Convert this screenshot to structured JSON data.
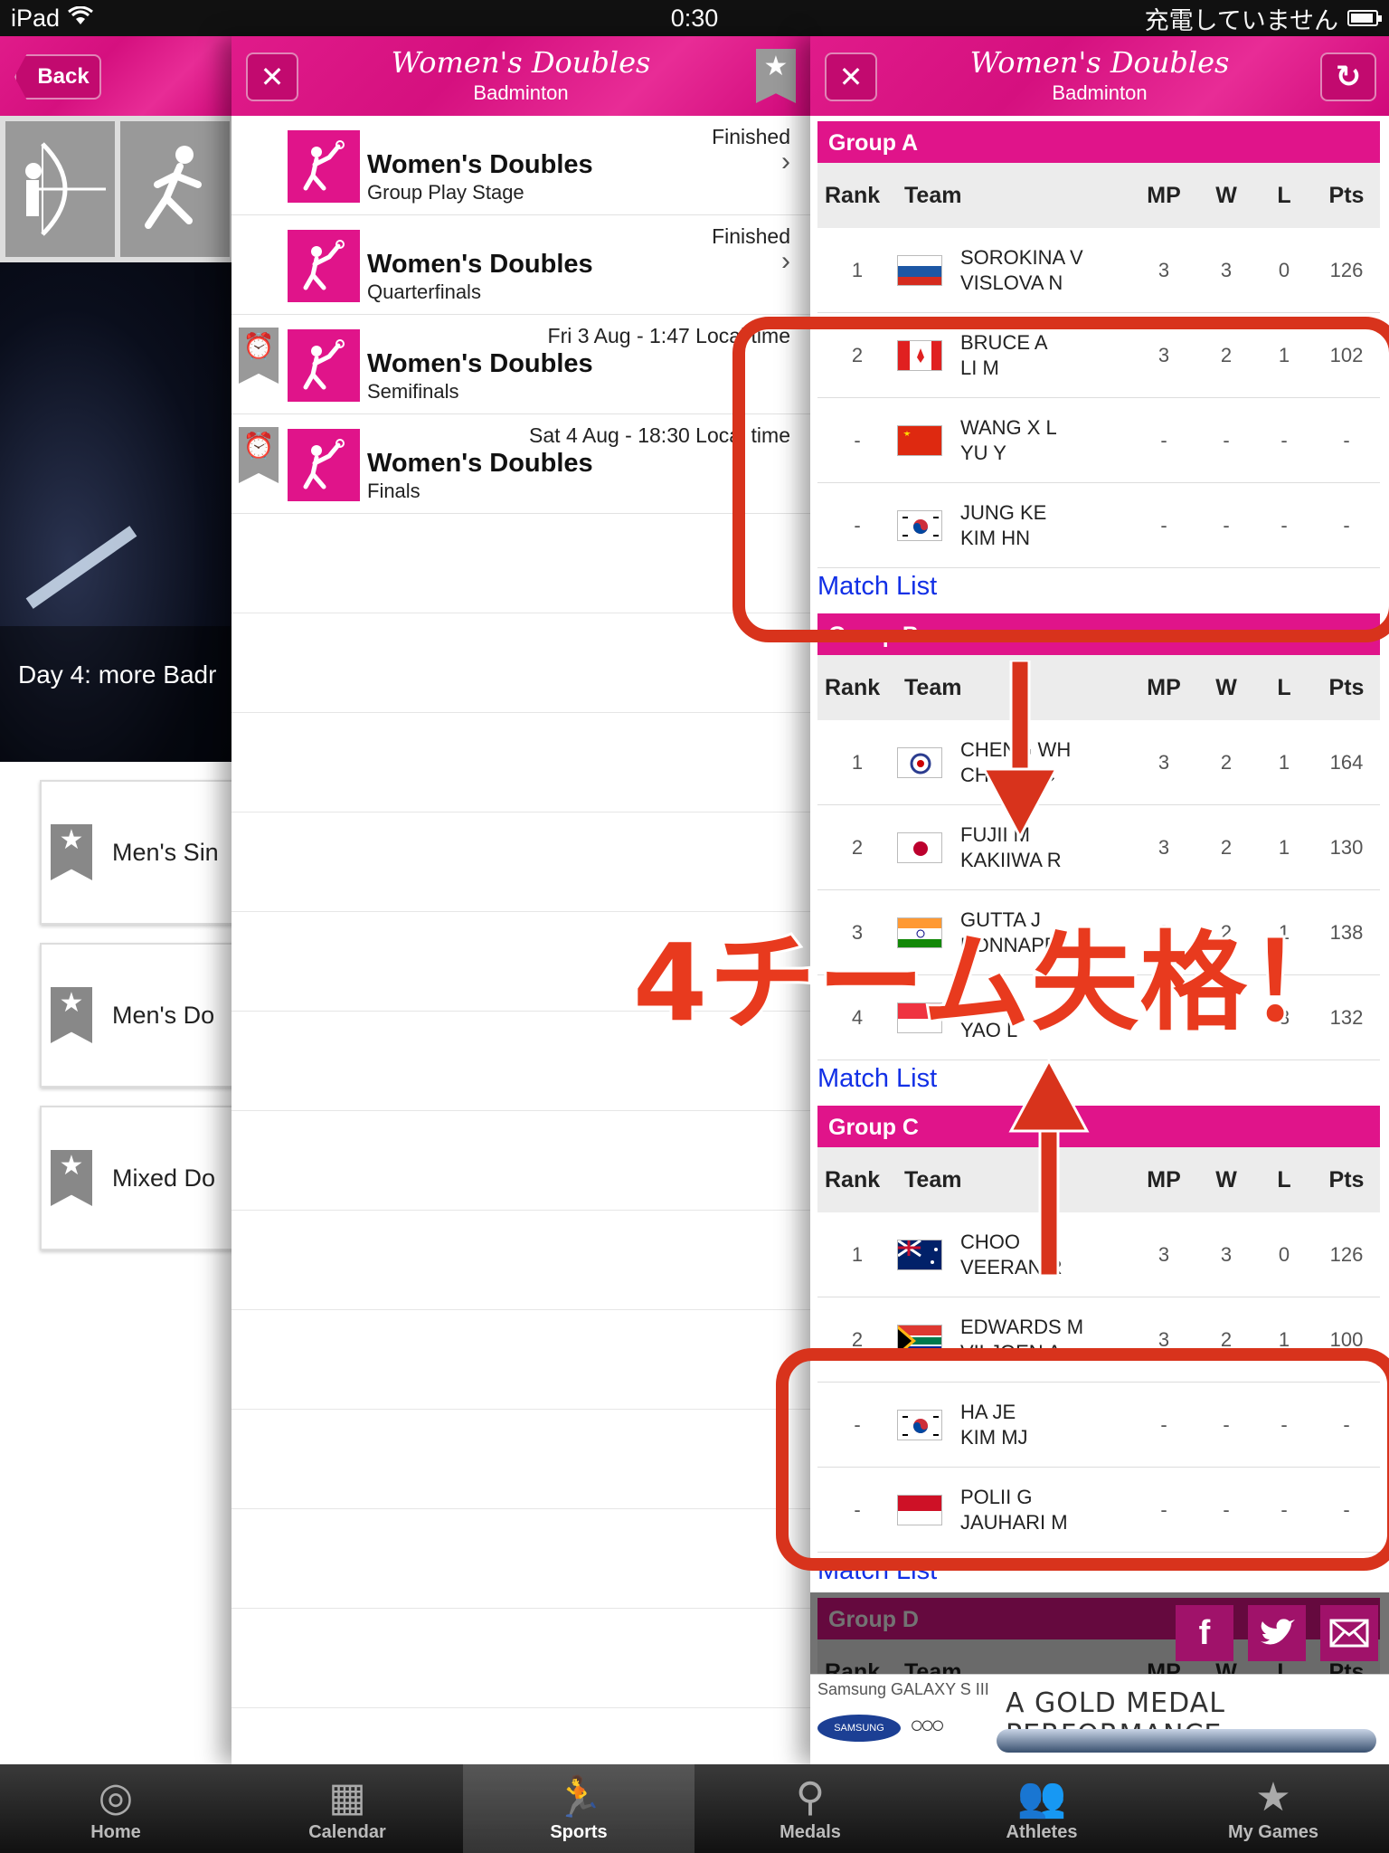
{
  "status": {
    "device": "iPad",
    "time": "0:30",
    "charge_status": "充電していません"
  },
  "left_panel": {
    "back_label": "Back",
    "caption": "Day 4: more Badr",
    "events": [
      "Men's Sin",
      "Men's Do",
      "Mixed Do"
    ]
  },
  "schedule_panel": {
    "title": "Women's Doubles",
    "subtitle": "Badminton",
    "rows": [
      {
        "status": "Finished",
        "name": "Women's Doubles",
        "stage": "Group Play Stage"
      },
      {
        "status": "Finished",
        "name": "Women's Doubles",
        "stage": "Quarterfinals"
      },
      {
        "status": "Fri 3 Aug - 1:47 Local time",
        "name": "Women's Doubles",
        "stage": "Semifinals"
      },
      {
        "status": "Sat 4 Aug - 18:30 Local time",
        "name": "Women's Doubles",
        "stage": "Finals"
      }
    ]
  },
  "standings_panel": {
    "title": "Women's Doubles",
    "subtitle": "Badminton",
    "headers": {
      "rank": "Rank",
      "team": "Team",
      "mp": "MP",
      "w": "W",
      "l": "L",
      "pts": "Pts"
    },
    "match_list": "Match List",
    "groups": [
      {
        "name": "Group A",
        "rows": [
          {
            "rank": "1",
            "p1": "SOROKINA V",
            "p2": "VISLOVA N",
            "mp": "3",
            "w": "3",
            "l": "0",
            "pts": "126",
            "flag": "russia"
          },
          {
            "rank": "2",
            "p1": "BRUCE A",
            "p2": "LI M",
            "mp": "3",
            "w": "2",
            "l": "1",
            "pts": "102",
            "flag": "canada"
          },
          {
            "rank": "-",
            "p1": "WANG X L",
            "p2": "YU Y",
            "mp": "-",
            "w": "-",
            "l": "-",
            "pts": "-",
            "flag": "china"
          },
          {
            "rank": "-",
            "p1": "JUNG KE",
            "p2": "KIM HN",
            "mp": "-",
            "w": "-",
            "l": "-",
            "pts": "-",
            "flag": "korea"
          }
        ]
      },
      {
        "name": "Group B",
        "rows": [
          {
            "rank": "1",
            "p1": "CHENG WH",
            "p2": "CHIEN YC",
            "mp": "3",
            "w": "2",
            "l": "1",
            "pts": "164",
            "flag": "taipei"
          },
          {
            "rank": "2",
            "p1": "FUJII M",
            "p2": "KAKIIWA R",
            "mp": "3",
            "w": "2",
            "l": "1",
            "pts": "130",
            "flag": "japan"
          },
          {
            "rank": "3",
            "p1": "GUTTA J",
            "p2": "PONNAPPA A",
            "mp": "3",
            "w": "2",
            "l": "1",
            "pts": "138",
            "flag": "india"
          },
          {
            "rank": "4",
            "p1": "",
            "p2": "YAO L",
            "mp": "3",
            "w": "",
            "l": "3",
            "pts": "132",
            "flag": "singapore"
          }
        ]
      },
      {
        "name": "Group C",
        "rows": [
          {
            "rank": "1",
            "p1": "CHOO",
            "p2": "VEERAN R",
            "mp": "3",
            "w": "3",
            "l": "0",
            "pts": "126",
            "flag": "australia"
          },
          {
            "rank": "2",
            "p1": "EDWARDS M",
            "p2": "VILJOEN A",
            "mp": "3",
            "w": "2",
            "l": "1",
            "pts": "100",
            "flag": "southafrica"
          },
          {
            "rank": "-",
            "p1": "HA JE",
            "p2": "KIM MJ",
            "mp": "-",
            "w": "-",
            "l": "-",
            "pts": "-",
            "flag": "korea"
          },
          {
            "rank": "-",
            "p1": "POLII G",
            "p2": "JAUHARI M",
            "mp": "-",
            "w": "-",
            "l": "-",
            "pts": "-",
            "flag": "indonesia"
          }
        ]
      },
      {
        "name": "Group D",
        "rows": []
      }
    ]
  },
  "annotation": {
    "text": "4チーム失格！"
  },
  "ad": {
    "brand_line": "Samsung GALAXY S III",
    "brand": "SAMSUNG",
    "slogan": "A GOLD MEDAL PERFORMANCE"
  },
  "tabs": [
    {
      "label": "Home",
      "icon": "target-icon"
    },
    {
      "label": "Calendar",
      "icon": "calendar-icon"
    },
    {
      "label": "Sports",
      "icon": "runner-icon",
      "active": true
    },
    {
      "label": "Medals",
      "icon": "medal-icon"
    },
    {
      "label": "Athletes",
      "icon": "athletes-icon"
    },
    {
      "label": "My Games",
      "icon": "star-icon"
    }
  ],
  "colors": {
    "pink": "#e0148a",
    "annotation_red": "#d8331c",
    "link_blue": "#1230e6"
  }
}
